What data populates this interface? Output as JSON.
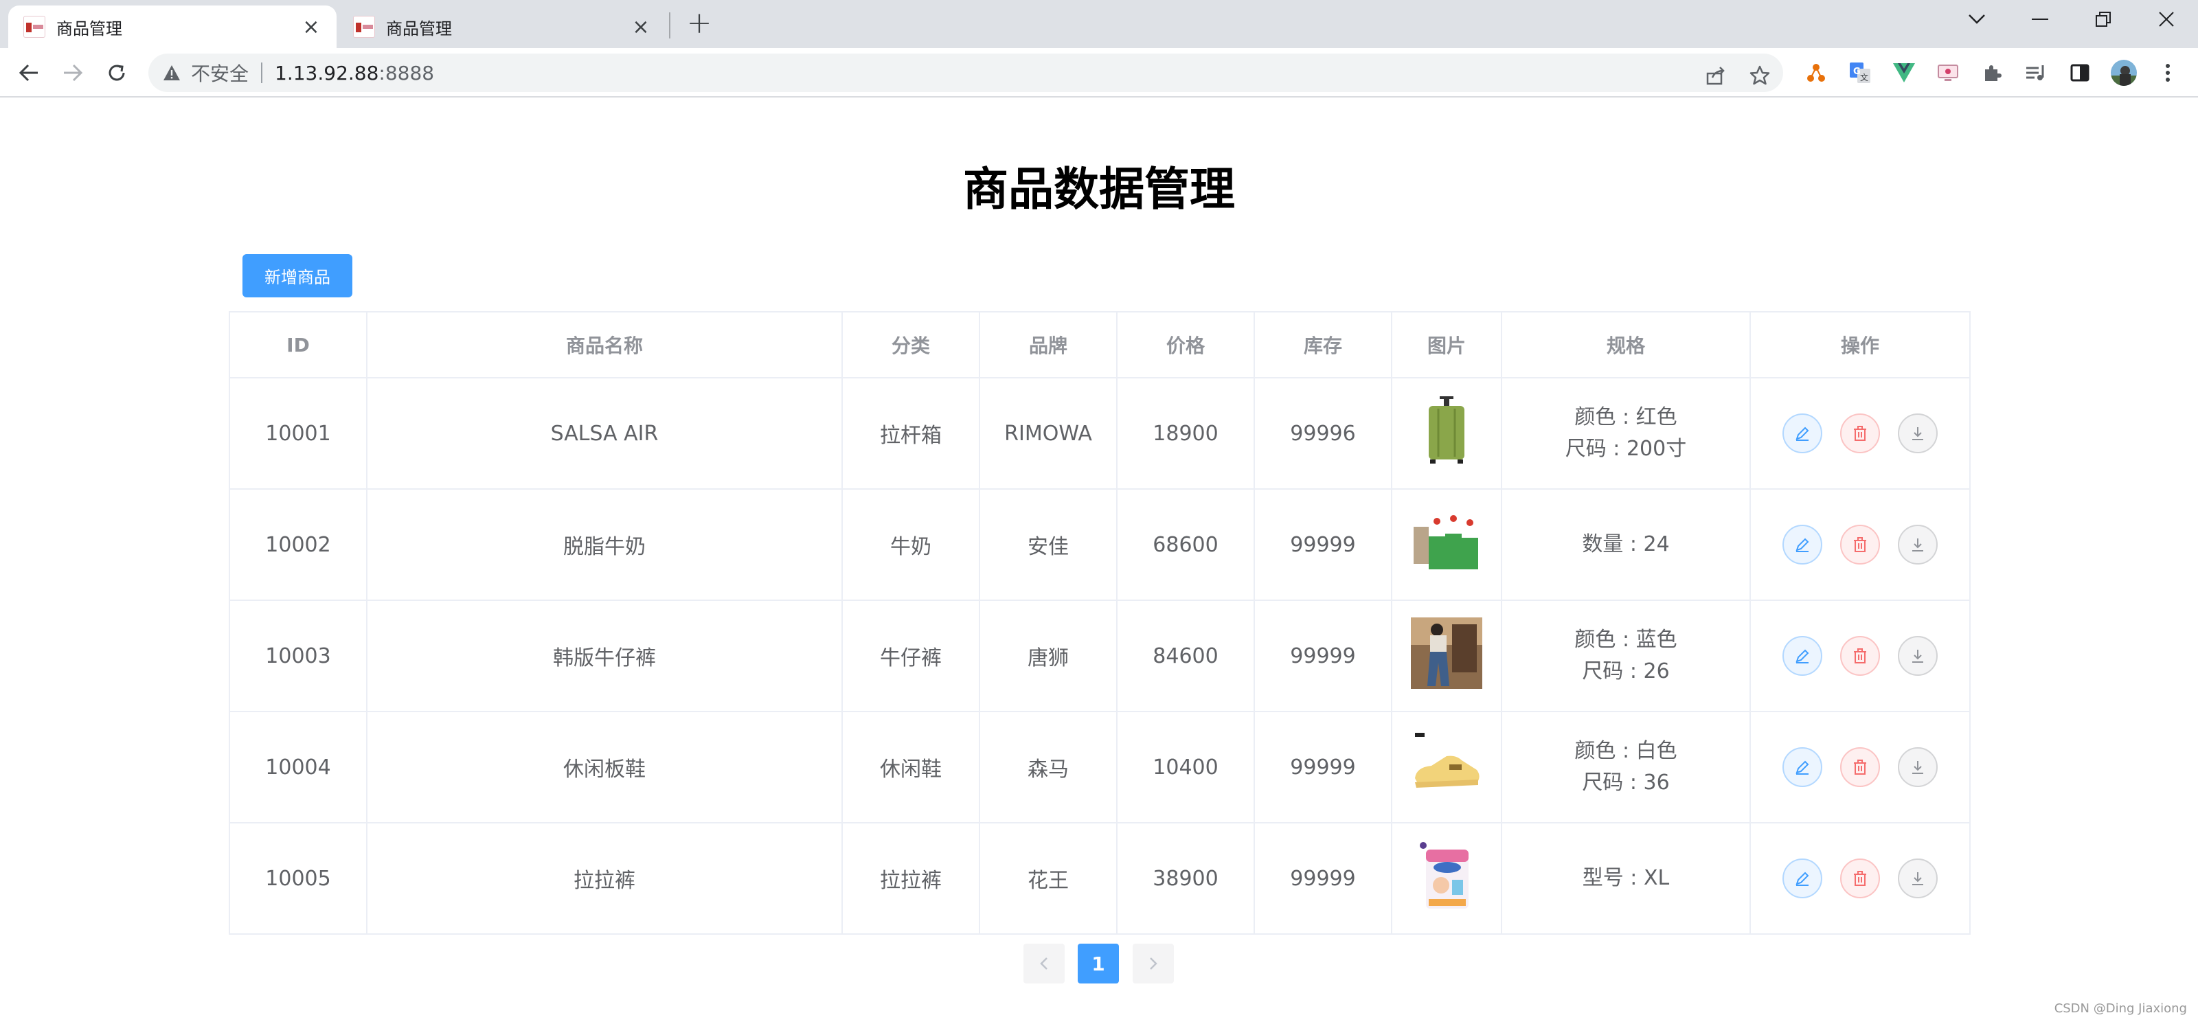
{
  "browser": {
    "tabs": [
      {
        "title": "商品管理",
        "active": true
      },
      {
        "title": "商品管理",
        "active": false
      }
    ],
    "url_security": "不安全",
    "url_host": "1.13.92.88",
    "url_port": ":8888"
  },
  "page": {
    "title": "商品数据管理",
    "add_button": "新增商品"
  },
  "table": {
    "columns": [
      "ID",
      "商品名称",
      "分类",
      "品牌",
      "价格",
      "库存",
      "图片",
      "规格",
      "操作"
    ],
    "rows": [
      {
        "id": "10001",
        "name": "SALSA AIR",
        "category": "拉杆箱",
        "brand": "RIMOWA",
        "price": "18900",
        "stock": "99996",
        "image": "green-suitcase",
        "spec_line1": "颜色 : 红色",
        "spec_line2": "尺码 : 200寸"
      },
      {
        "id": "10002",
        "name": "脱脂牛奶",
        "category": "牛奶",
        "brand": "安佳",
        "price": "68600",
        "stock": "99999",
        "image": "milk-cartons",
        "spec_line1": "数量 : 24",
        "spec_line2": ""
      },
      {
        "id": "10003",
        "name": "韩版牛仔裤",
        "category": "牛仔裤",
        "brand": "唐狮",
        "price": "84600",
        "stock": "99999",
        "image": "jeans-photo",
        "spec_line1": "颜色 : 蓝色",
        "spec_line2": "尺码 : 26"
      },
      {
        "id": "10004",
        "name": "休闲板鞋",
        "category": "休闲鞋",
        "brand": "森马",
        "price": "10400",
        "stock": "99999",
        "image": "yellow-sneaker",
        "spec_line1": "颜色 : 白色",
        "spec_line2": "尺码 : 36"
      },
      {
        "id": "10005",
        "name": "拉拉裤",
        "category": "拉拉裤",
        "brand": "花王",
        "price": "38900",
        "stock": "99999",
        "image": "diaper-pack",
        "spec_line1": "型号 : XL",
        "spec_line2": ""
      }
    ]
  },
  "pagination": {
    "current": "1",
    "prev_icon": "chevron-left-icon",
    "next_icon": "chevron-right-icon"
  },
  "watermark": "CSDN @Ding Jiaxiong",
  "colors": {
    "primary": "#409eff",
    "danger": "#f56c6c",
    "info": "#909399",
    "border": "#ebeef5"
  }
}
